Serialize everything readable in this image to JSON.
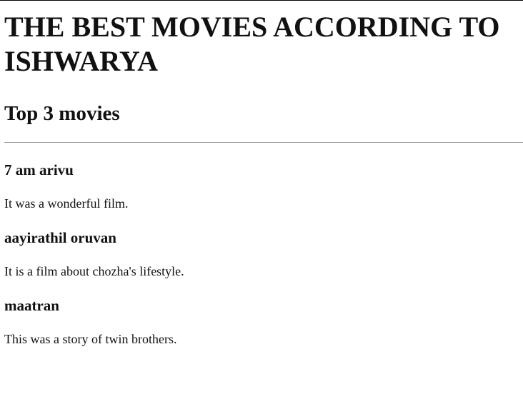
{
  "page": {
    "title": "THE BEST MOVIES ACCORDING TO ISHWARYA",
    "subtitle": "Top 3 movies"
  },
  "movies": [
    {
      "title": "7 am arivu",
      "description": "It was a wonderful film."
    },
    {
      "title": "aayirathil oruvan",
      "description": "It is a film about chozha's lifestyle."
    },
    {
      "title": "maatran",
      "description": "This was a story of twin brothers."
    }
  ]
}
